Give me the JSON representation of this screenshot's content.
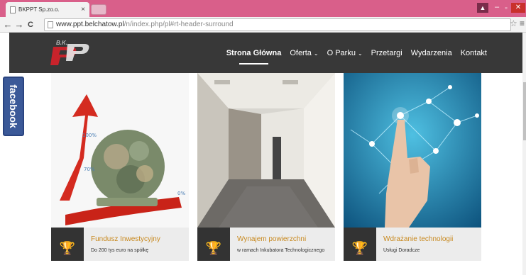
{
  "browser": {
    "tab_title": "BKPPT Sp.zo.o.",
    "tab_close": "×",
    "url_host": "www.ppt.belchatow.pl",
    "url_path": "/n/index.php/pl#rt-header-surround",
    "back": "←",
    "forward": "→",
    "reload": "C",
    "star": "☆",
    "menu": "≡",
    "win_user": "▲",
    "win_min": "–",
    "win_max": "▫",
    "win_close": "✕"
  },
  "site": {
    "logo_text": "BK PPT",
    "nav": [
      {
        "label": "Strona Główna",
        "active": true,
        "dropdown": false
      },
      {
        "label": "Oferta",
        "active": false,
        "dropdown": true
      },
      {
        "label": "O Parku",
        "active": false,
        "dropdown": true
      },
      {
        "label": "Przetargi",
        "active": false,
        "dropdown": false
      },
      {
        "label": "Wydarzenia",
        "active": false,
        "dropdown": false
      },
      {
        "label": "Kontakt",
        "active": false,
        "dropdown": false
      }
    ],
    "caret": "⌄",
    "facebook_label": "facebook"
  },
  "cards": [
    {
      "title": "Fundusz Inwestycyjny",
      "subtitle": "Do 200 tys euro na spółkę",
      "icon": "trophy-icon",
      "image": "money-globe-arrow"
    },
    {
      "title": "Wynajem powierzchni",
      "subtitle": "w ramach Inkubatora Technologicznego",
      "icon": "trophy-icon",
      "image": "office-corridor"
    },
    {
      "title": "Wdrażanie technologii",
      "subtitle": "Usługi Doradcze",
      "icon": "trophy-icon",
      "image": "hand-network"
    }
  ],
  "trophy_glyph": "🏆",
  "colors": {
    "header_bg": "#383838",
    "accent_title": "#c8891f",
    "facebook_blue": "#3b5998",
    "titlebar_pink": "#d95f8a"
  }
}
